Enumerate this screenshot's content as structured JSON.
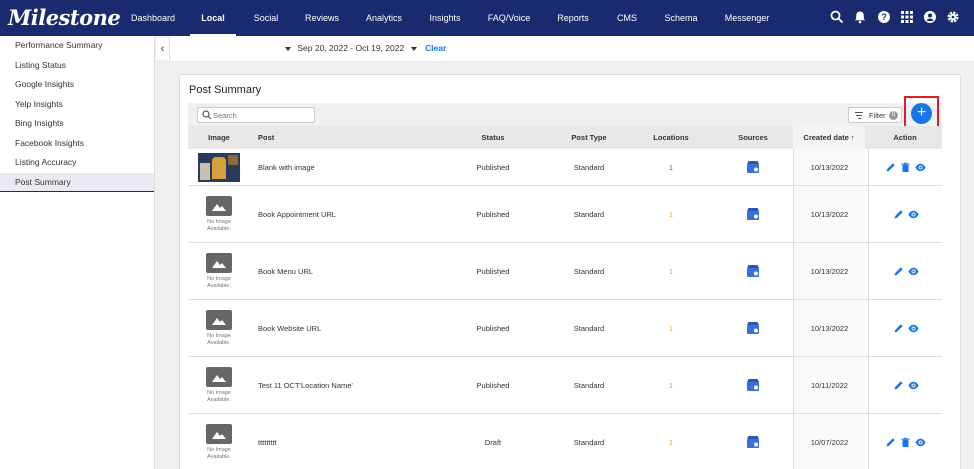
{
  "app": {
    "logo": "Milestone",
    "nav": [
      {
        "label": "Dashboard"
      },
      {
        "label": "Local"
      },
      {
        "label": "Social"
      },
      {
        "label": "Reviews"
      },
      {
        "label": "Analytics"
      },
      {
        "label": "Insights"
      },
      {
        "label": "FAQ/Voice"
      },
      {
        "label": "Reports"
      },
      {
        "label": "CMS"
      },
      {
        "label": "Schema"
      },
      {
        "label": "Messenger"
      }
    ],
    "active_nav": "Local",
    "top_icons": [
      "search-icon",
      "bell-icon",
      "help-icon",
      "apps-grid-icon",
      "account-icon",
      "settings-icon"
    ]
  },
  "sidebar": {
    "items": [
      {
        "label": "Performance Summary"
      },
      {
        "label": "Listing Status"
      },
      {
        "label": "Google Insights"
      },
      {
        "label": "Yelp Insights"
      },
      {
        "label": "Bing Insights"
      },
      {
        "label": "Facebook Insights"
      },
      {
        "label": "Listing Accuracy"
      },
      {
        "label": "Post Summary"
      }
    ],
    "active": "Post Summary"
  },
  "filters": {
    "date_range": "Sep 20, 2022 - Oct 19, 2022",
    "clear_label": "Clear"
  },
  "card": {
    "title": "Post Summary",
    "search_placeholder": "Search",
    "filter_label": "Filter",
    "filter_count": "0",
    "add_label": "+"
  },
  "table": {
    "columns": [
      "Image",
      "Post",
      "Status",
      "Post Type",
      "Locations",
      "Sources",
      "Created date",
      "Action"
    ],
    "sorted_column": "Created date",
    "sort_arrow": "↑",
    "no_image_text": "No Image Available.",
    "rows": [
      {
        "image": "photo",
        "post": "Blank with image",
        "status": "Published",
        "type": "Standard",
        "locations": "1",
        "loc_color": "green",
        "date": "10/13/2022",
        "actions": [
          "edit-icon",
          "delete-icon",
          "view-icon"
        ]
      },
      {
        "image": "none",
        "post": "Book Appointment URL",
        "status": "Published",
        "type": "Standard",
        "locations": "1",
        "loc_color": "orange",
        "date": "10/13/2022",
        "actions": [
          "edit-icon",
          "view-icon"
        ]
      },
      {
        "image": "none",
        "post": "Book Menu URL",
        "status": "Published",
        "type": "Standard",
        "locations": "1",
        "loc_color": "orange",
        "date": "10/13/2022",
        "actions": [
          "edit-icon",
          "view-icon"
        ]
      },
      {
        "image": "none",
        "post": "Book Website URL",
        "status": "Published",
        "type": "Standard",
        "locations": "1",
        "loc_color": "orange",
        "date": "10/13/2022",
        "actions": [
          "edit-icon",
          "view-icon"
        ]
      },
      {
        "image": "none",
        "post": "Test 11 OCT'Location Name'",
        "status": "Published",
        "type": "Standard",
        "locations": "1",
        "loc_color": "orange",
        "date": "10/11/2022",
        "actions": [
          "edit-icon",
          "view-icon"
        ]
      },
      {
        "image": "none",
        "post": "ttttttttt",
        "status": "Draft",
        "type": "Standard",
        "locations": "1",
        "loc_color": "orange",
        "date": "10/07/2022",
        "actions": [
          "edit-icon",
          "delete-icon",
          "view-icon"
        ]
      }
    ]
  },
  "colors": {
    "nav_bg": "#1a2a6e",
    "accent": "#1a73e8",
    "highlight_box": "#e02020",
    "loc_green": "#2e8b3e",
    "loc_orange": "#f0a030"
  }
}
